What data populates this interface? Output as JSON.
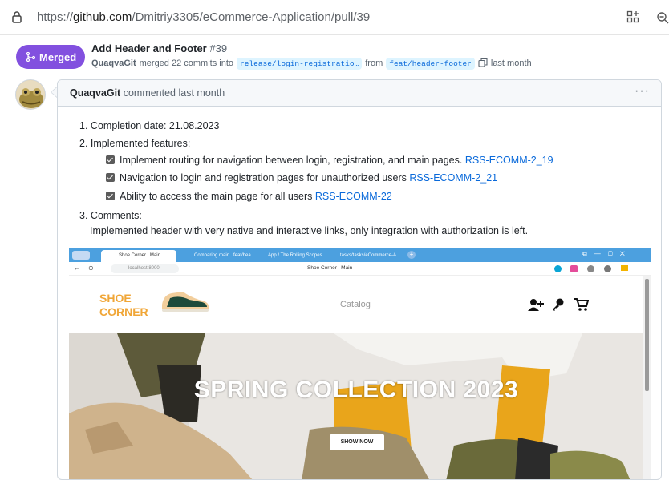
{
  "browser": {
    "url_prefix": "https://",
    "url_host": "github.com",
    "url_path": "/Dmitriy3305/eCommerce-Application/pull/39"
  },
  "pr": {
    "state": "Merged",
    "title": "Add Header and Footer",
    "number": "#39",
    "author": "QuaqvaGit",
    "merged_text": "merged 22 commits into",
    "base_branch": "release/login-registratio…",
    "from_text": "from",
    "head_branch": "feat/header-footer",
    "time": "last month"
  },
  "comment": {
    "author": "QuaqvaGit",
    "action": "commented last month",
    "menu": "···",
    "items": [
      {
        "num": "1.",
        "text": "Completion date: 21.08.2023"
      },
      {
        "num": "2.",
        "text": "Implemented features:"
      },
      {
        "num": "3.",
        "text": "Comments:"
      }
    ],
    "features": [
      {
        "text": "Implement routing for navigation between login, registration, and main pages.",
        "link": "RSS-ECOMM-2_19"
      },
      {
        "text": "Navigation to login and registration pages for unauthorized users",
        "link": "RSS-ECOMM-2_21"
      },
      {
        "text": "Ability to access the main page for all users",
        "link": "RSS-ECOMM-22"
      }
    ],
    "comment_text": "Implemented header with very native and interactive links, only integration with authorization is left."
  },
  "screenshot": {
    "tabs": [
      "Shoe Corner | Main",
      "Comparing main...feat/hea",
      "App / The Rolling Scopes",
      "tasks/tasks/eCommerce-A"
    ],
    "address": "localhost:8000",
    "page_title": "Shoe Corner | Main",
    "logo_line1": "SHOE",
    "logo_line2": "CORNER",
    "nav_catalog": "Catalog",
    "hero_title": "SPRING COLLECTION 2023",
    "hero_button": "SHOW NOW"
  }
}
